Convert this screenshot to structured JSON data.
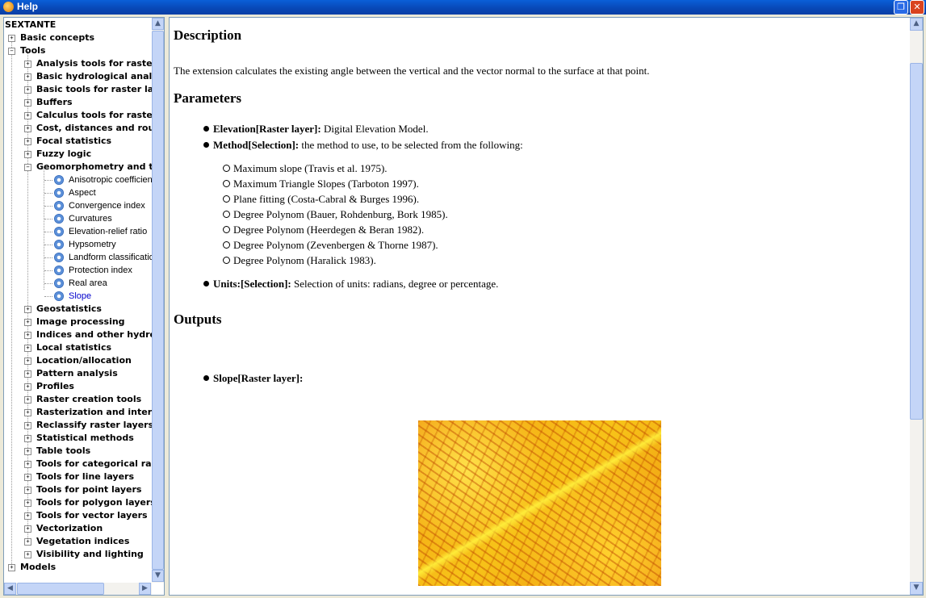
{
  "window": {
    "title": "Help",
    "restore_glyph": "❐",
    "close_glyph": "✕"
  },
  "tree": {
    "root": "SEXTANTE",
    "top": [
      {
        "label": "Basic concepts"
      },
      {
        "label": "Tools"
      }
    ],
    "tools": [
      "Analysis tools for raster l",
      "Basic hydrological analys",
      "Basic tools for raster laye",
      "Buffers",
      "Calculus tools for raster l",
      "Cost, distances and route",
      "Focal statistics",
      "Fuzzy logic",
      "Geomorphometry and ter"
    ],
    "geomorph_leaves": [
      "Anisotropic coefficien",
      "Aspect",
      "Convergence index",
      "Curvatures",
      "Elevation-relief ratio",
      "Hypsometry",
      "Landform classificatio",
      "Protection index",
      "Real area",
      "Slope"
    ],
    "tools_after": [
      "Geostatistics",
      "Image processing",
      "Indices and other hydrolo",
      "Local statistics",
      "Location/allocation",
      "Pattern analysis",
      "Profiles",
      "Raster creation tools",
      "Rasterization and interpo",
      "Reclassify raster layers",
      "Statistical methods",
      "Table tools",
      "Tools for categorical rast",
      "Tools for line layers",
      "Tools for point layers",
      "Tools for polygon layers",
      "Tools for vector layers",
      "Vectorization",
      "Vegetation indices",
      "Visibility and lighting"
    ],
    "last": "Models",
    "expand_glyph": "+",
    "collapse_glyph": "−"
  },
  "content": {
    "description_heading": "Description",
    "description_text": "The extension calculates the existing angle between the vertical and the vector normal to the surface at that point.",
    "parameters_heading": "Parameters",
    "params": [
      {
        "name": "Elevation[Raster layer]:",
        "desc": " Digital Elevation Model."
      },
      {
        "name": "Method[Selection]:",
        "desc": " the method to use, to be selected from the following:"
      }
    ],
    "methods": [
      "Maximum slope (Travis et al. 1975).",
      "Maximum Triangle Slopes (Tarboton 1997).",
      "Plane fitting (Costa-Cabral & Burges 1996).",
      "Degree Polynom (Bauer, Rohdenburg, Bork 1985).",
      "Degree Polynom (Heerdegen & Beran 1982).",
      "Degree Polynom (Zevenbergen & Thorne 1987).",
      "Degree Polynom (Haralick 1983)."
    ],
    "units_param": {
      "name": "Units:[Selection]:",
      "desc": " Selection of units: radians, degree or percentage."
    },
    "outputs_heading": "Outputs",
    "output": {
      "name": "Slope[Raster layer]:"
    }
  },
  "scroll": {
    "up": "▲",
    "down": "▼",
    "left": "◀",
    "right": "▶"
  }
}
